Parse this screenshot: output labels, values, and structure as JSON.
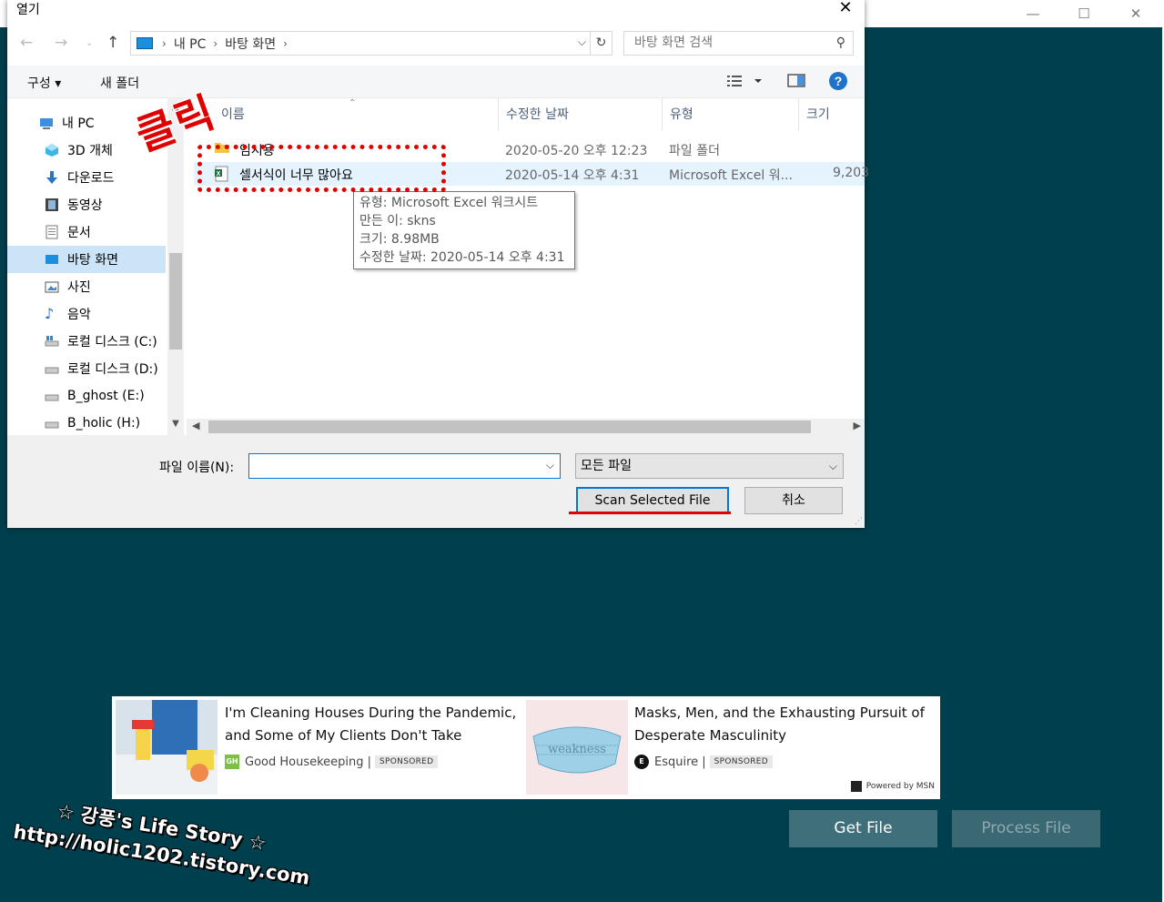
{
  "dialog": {
    "title": "열기",
    "close_glyph": "✕",
    "breadcrumb": [
      "내 PC",
      "바탕 화면"
    ],
    "search_placeholder": "바탕 화면 검색",
    "toolbar": {
      "organize": "구성 ▾",
      "new_folder": "새 폴더",
      "help": "?"
    },
    "sidebar": [
      {
        "label": "내 PC",
        "icon": "pc-icon"
      },
      {
        "label": "3D 개체",
        "icon": "cube-icon"
      },
      {
        "label": "다운로드",
        "icon": "download-icon"
      },
      {
        "label": "동영상",
        "icon": "video-icon"
      },
      {
        "label": "문서",
        "icon": "document-icon"
      },
      {
        "label": "바탕 화면",
        "icon": "desktop-icon",
        "selected": true
      },
      {
        "label": "사진",
        "icon": "picture-icon"
      },
      {
        "label": "음악",
        "icon": "music-icon"
      },
      {
        "label": "로컬 디스크 (C:)",
        "icon": "drive-c-icon"
      },
      {
        "label": "로컬 디스크 (D:)",
        "icon": "drive-icon"
      },
      {
        "label": "B_ghost (E:)",
        "icon": "drive-icon"
      },
      {
        "label": "B_holic (H:)",
        "icon": "drive-icon"
      }
    ],
    "columns": {
      "name": "이름",
      "modified": "수정한 날짜",
      "type": "유형",
      "size": "크기"
    },
    "files": [
      {
        "name": "임시용",
        "modified": "2020-05-20 오후 12:23",
        "type": "파일 폴더",
        "size": "",
        "icon": "folder-icon"
      },
      {
        "name": "셀서식이 너무 많아요",
        "modified": "2020-05-14 오후 4:31",
        "type": "Microsoft Excel 워...",
        "size": "9,203",
        "icon": "excel-file-icon",
        "selected": true
      }
    ],
    "tooltip": [
      "유형: Microsoft Excel 워크시트",
      "만든 이: skns",
      "크기: 8.98MB",
      "수정한 날짜: 2020-05-14 오후 4:31"
    ],
    "filename_label": "파일 이름(N):",
    "filename_value": "",
    "filetype": "모든 파일",
    "open_button": "Scan Selected File",
    "cancel_button": "취소"
  },
  "annotation": {
    "click_word": "클릭"
  },
  "ads": [
    {
      "title": "I'm Cleaning Houses During the Pandemic, and Some of My Clients Don't Take",
      "source": "Good Housekeeping |",
      "badge": "SPONSORED",
      "logo": "GH"
    },
    {
      "title": "Masks, Men, and the Exhausting Pursuit of Desperate Masculinity",
      "source": "Esquire |",
      "badge": "SPONSORED",
      "logo": "E"
    }
  ],
  "ad_mask_text": "weakness",
  "powered_by": "Powered by MSN",
  "app_buttons": {
    "get_file": "Get File",
    "process_file": "Process File"
  },
  "watermark": {
    "line1": "☆ 강풍's Life Story ☆",
    "line2": "http://holic1202.tistory.com"
  },
  "colors": {
    "app_bg": "#003f4d",
    "accent": "#0078d7",
    "annotation": "#e00000",
    "button_bg": "#3f6f7a"
  }
}
